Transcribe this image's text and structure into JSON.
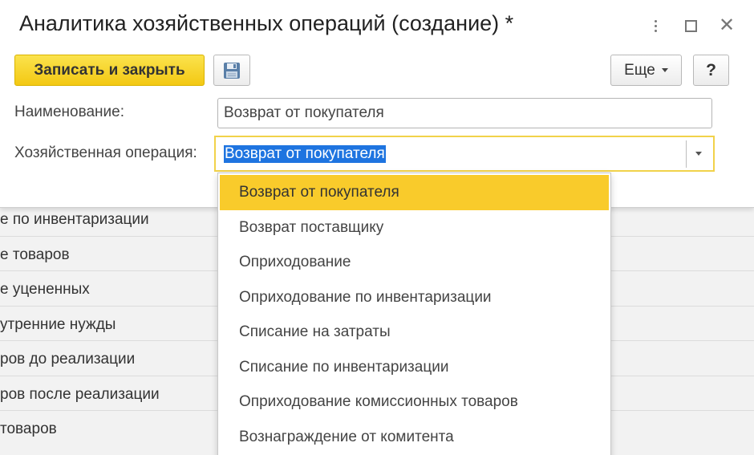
{
  "window": {
    "title": "Аналитика хозяйственных операций (создание) *"
  },
  "toolbar": {
    "save_close_label": "Записать и закрыть",
    "more_label": "Еще",
    "help_label": "?"
  },
  "form": {
    "name_label": "Наименование:",
    "name_value": "Возврат от покупателя",
    "operation_label": "Хозяйственная операция:",
    "operation_value": "Возврат от покупателя"
  },
  "dropdown": {
    "options": [
      "Возврат от покупателя",
      "Возврат поставщику",
      "Оприходование",
      "Оприходование по инвентаризации",
      "Списание на затраты",
      "Списание по инвентаризации",
      "Оприходование комиссионных товаров",
      "Вознаграждение от комитента"
    ],
    "selected_index": 0
  },
  "background_list": {
    "rows": [
      "е по инвентаризации",
      "е товаров",
      "е уцененных",
      "утренние нужды",
      "ров до реализации",
      "ров после реализации",
      "товаров"
    ]
  },
  "colors": {
    "primary_button": "#f3c813",
    "selected_item": "#f9cb2b",
    "focus_border": "#f1d24a",
    "text_selection": "#1e74e0"
  }
}
